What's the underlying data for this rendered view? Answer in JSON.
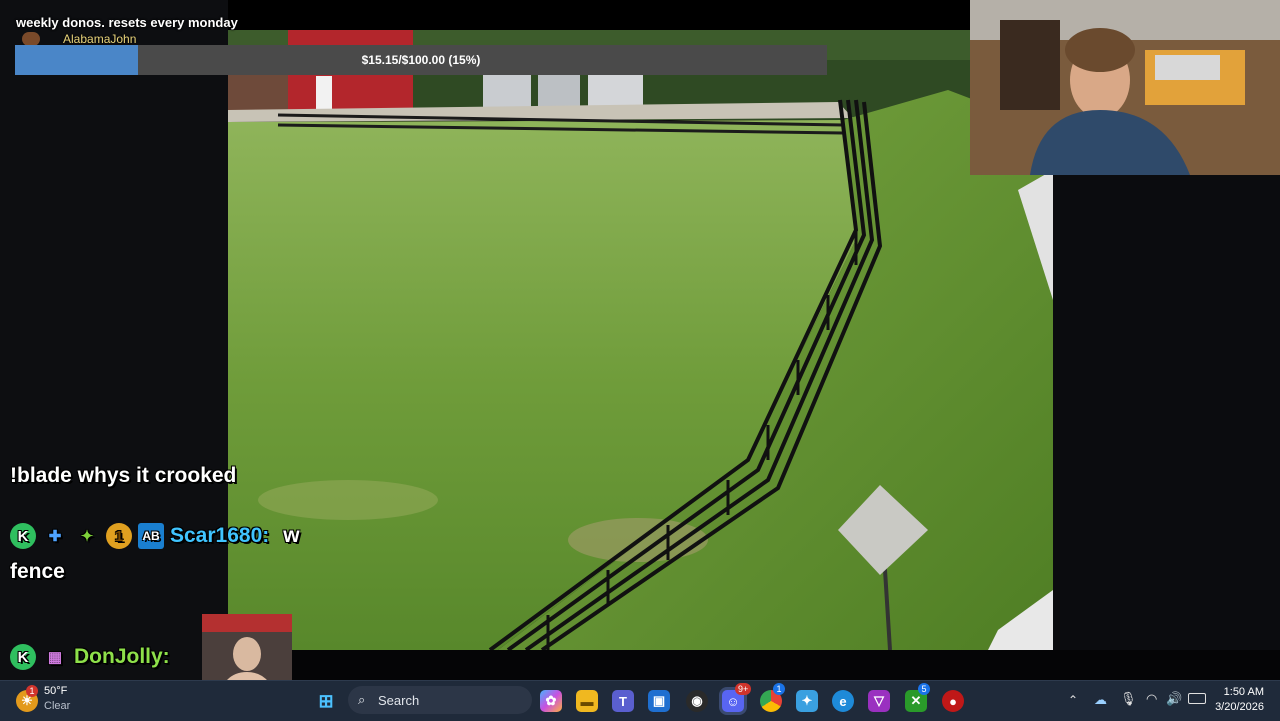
{
  "overlay": {
    "dono_title": "weekly donos. resets every monday",
    "dono_user": "AlabamaJohn",
    "dono_progress_text": "$15.15/$100.00 (15%)",
    "dono_progress_fraction": 0.1515,
    "colors": {
      "bar_fill": "#4a86c8",
      "bar_track": "#4a4a4a",
      "username": "#e8d37a"
    }
  },
  "chat": {
    "messages": [
      {
        "text": "!blade whys it crooked"
      },
      {
        "user": "Scar1680:",
        "text": "w",
        "continuation": "fence",
        "user_color": "#40c4ff",
        "badges": [
          "K",
          "sword",
          "star",
          "1",
          "AB"
        ]
      },
      {
        "user": "DonJolly:",
        "text": "",
        "user_color": "#8ee04a",
        "badges": [
          "K",
          "gift"
        ]
      }
    ]
  },
  "taskbar": {
    "weather_temp": "50°F",
    "weather_desc": "Clear",
    "weather_badge": "1",
    "search_label": "Search",
    "time": "1:50 AM",
    "date": "3/20/2026",
    "badges": {
      "discord": "9+",
      "chrome": "1",
      "xbox": "5"
    }
  }
}
